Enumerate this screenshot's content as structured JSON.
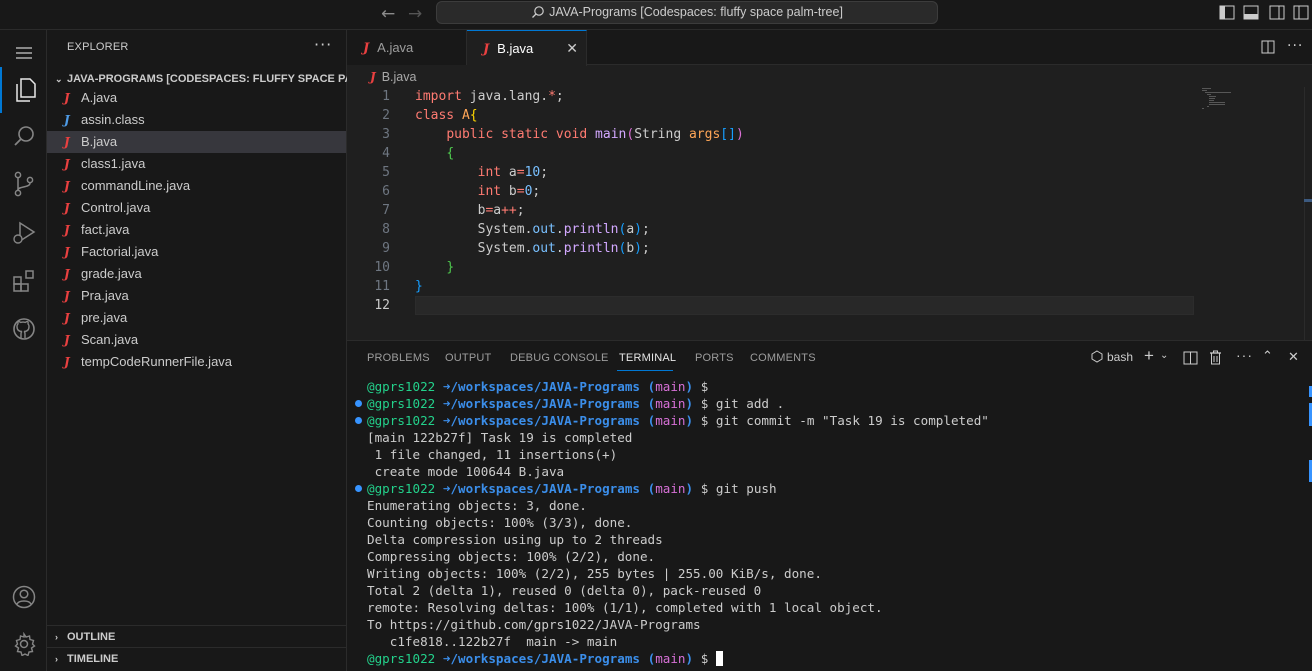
{
  "titlebar": {
    "title": "JAVA-Programs [Codespaces: fluffy space palm-tree]"
  },
  "sidebar": {
    "title": "EXPLORER",
    "more": "···",
    "folder": "JAVA-PROGRAMS [CODESPACES: FLUFFY SPACE PAL...",
    "files": [
      {
        "name": "A.java",
        "icon": "java-icon"
      },
      {
        "name": "assin.class",
        "icon": "class-icon"
      },
      {
        "name": "B.java",
        "icon": "java-icon"
      },
      {
        "name": "class1.java",
        "icon": "java-icon"
      },
      {
        "name": "commandLine.java",
        "icon": "java-icon"
      },
      {
        "name": "Control.java",
        "icon": "java-icon"
      },
      {
        "name": "fact.java",
        "icon": "java-icon"
      },
      {
        "name": "Factorial.java",
        "icon": "java-icon"
      },
      {
        "name": "grade.java",
        "icon": "java-icon"
      },
      {
        "name": "Pra.java",
        "icon": "java-icon"
      },
      {
        "name": "pre.java",
        "icon": "java-icon"
      },
      {
        "name": "Scan.java",
        "icon": "java-icon"
      },
      {
        "name": "tempCodeRunnerFile.java",
        "icon": "java-icon"
      }
    ],
    "outline": "OUTLINE",
    "timeline": "TIMELINE"
  },
  "tabs": [
    {
      "label": "A.java",
      "icon_glyph": "J"
    },
    {
      "label": "B.java",
      "icon_glyph": "J"
    }
  ],
  "breadcrumb": {
    "file": "B.java",
    "icon_glyph": "J"
  },
  "editor": {
    "line_numbers": [
      "1",
      "2",
      "3",
      "4",
      "5",
      "6",
      "7",
      "8",
      "9",
      "10",
      "11",
      "12"
    ]
  },
  "panel": {
    "tabs": [
      "PROBLEMS",
      "OUTPUT",
      "DEBUG CONSOLE",
      "TERMINAL",
      "PORTS",
      "COMMENTS"
    ],
    "shell": "bash"
  },
  "terminal": {
    "user": "@gprs1022",
    "arrow": "➜",
    "path": "/workspaces/JAVA-Programs",
    "branch_open": "(",
    "branch": "main",
    "branch_close": ")",
    "prompt": "$",
    "cmd_add": "git add .",
    "cmd_commit": "git commit -m \"Task 19 is completed\"",
    "cmd_push": "git push",
    "output1": [
      "[main 122b27f] Task 19 is completed",
      " 1 file changed, 11 insertions(+)",
      " create mode 100644 B.java"
    ],
    "output2": [
      "Enumerating objects: 3, done.",
      "Counting objects: 100% (3/3), done.",
      "Delta compression using up to 2 threads",
      "Compressing objects: 100% (2/2), done.",
      "Writing objects: 100% (2/2), 255 bytes | 255.00 KiB/s, done.",
      "Total 2 (delta 1), reused 0 (delta 0), pack-reused 0",
      "remote: Resolving deltas: 100% (1/1), completed with 1 local object.",
      "To https://github.com/gprs1022/JAVA-Programs",
      "   c1fe818..122b27f  main -> main"
    ]
  },
  "colors": {
    "accent": "#0078d4",
    "java_icon": "#e94040",
    "class_icon": "#4e9be6",
    "prompt_user": "#23d18b",
    "prompt_path": "#3b8eea",
    "prompt_branch": "#d670d6"
  }
}
